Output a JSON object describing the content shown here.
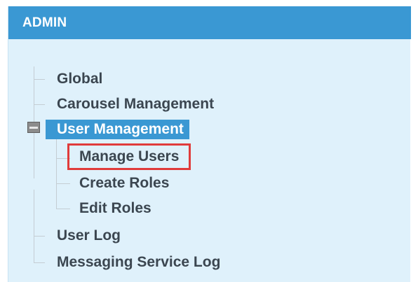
{
  "panel": {
    "title": "ADMIN"
  },
  "tree": {
    "items": [
      {
        "label": "Global"
      },
      {
        "label": "Carousel Management"
      },
      {
        "label": "User Management",
        "expanded": true,
        "selected": true,
        "children": [
          {
            "label": "Manage Users",
            "highlighted": true
          },
          {
            "label": "Create Roles"
          },
          {
            "label": "Edit Roles"
          }
        ]
      },
      {
        "label": "User Log"
      },
      {
        "label": "Messaging Service Log"
      }
    ]
  },
  "colors": {
    "header_bg": "#3a98d3",
    "panel_bg": "#dff1fb",
    "selected_bg": "#3a98d3",
    "highlight_border": "#e03b3b",
    "text": "#3b4650"
  }
}
